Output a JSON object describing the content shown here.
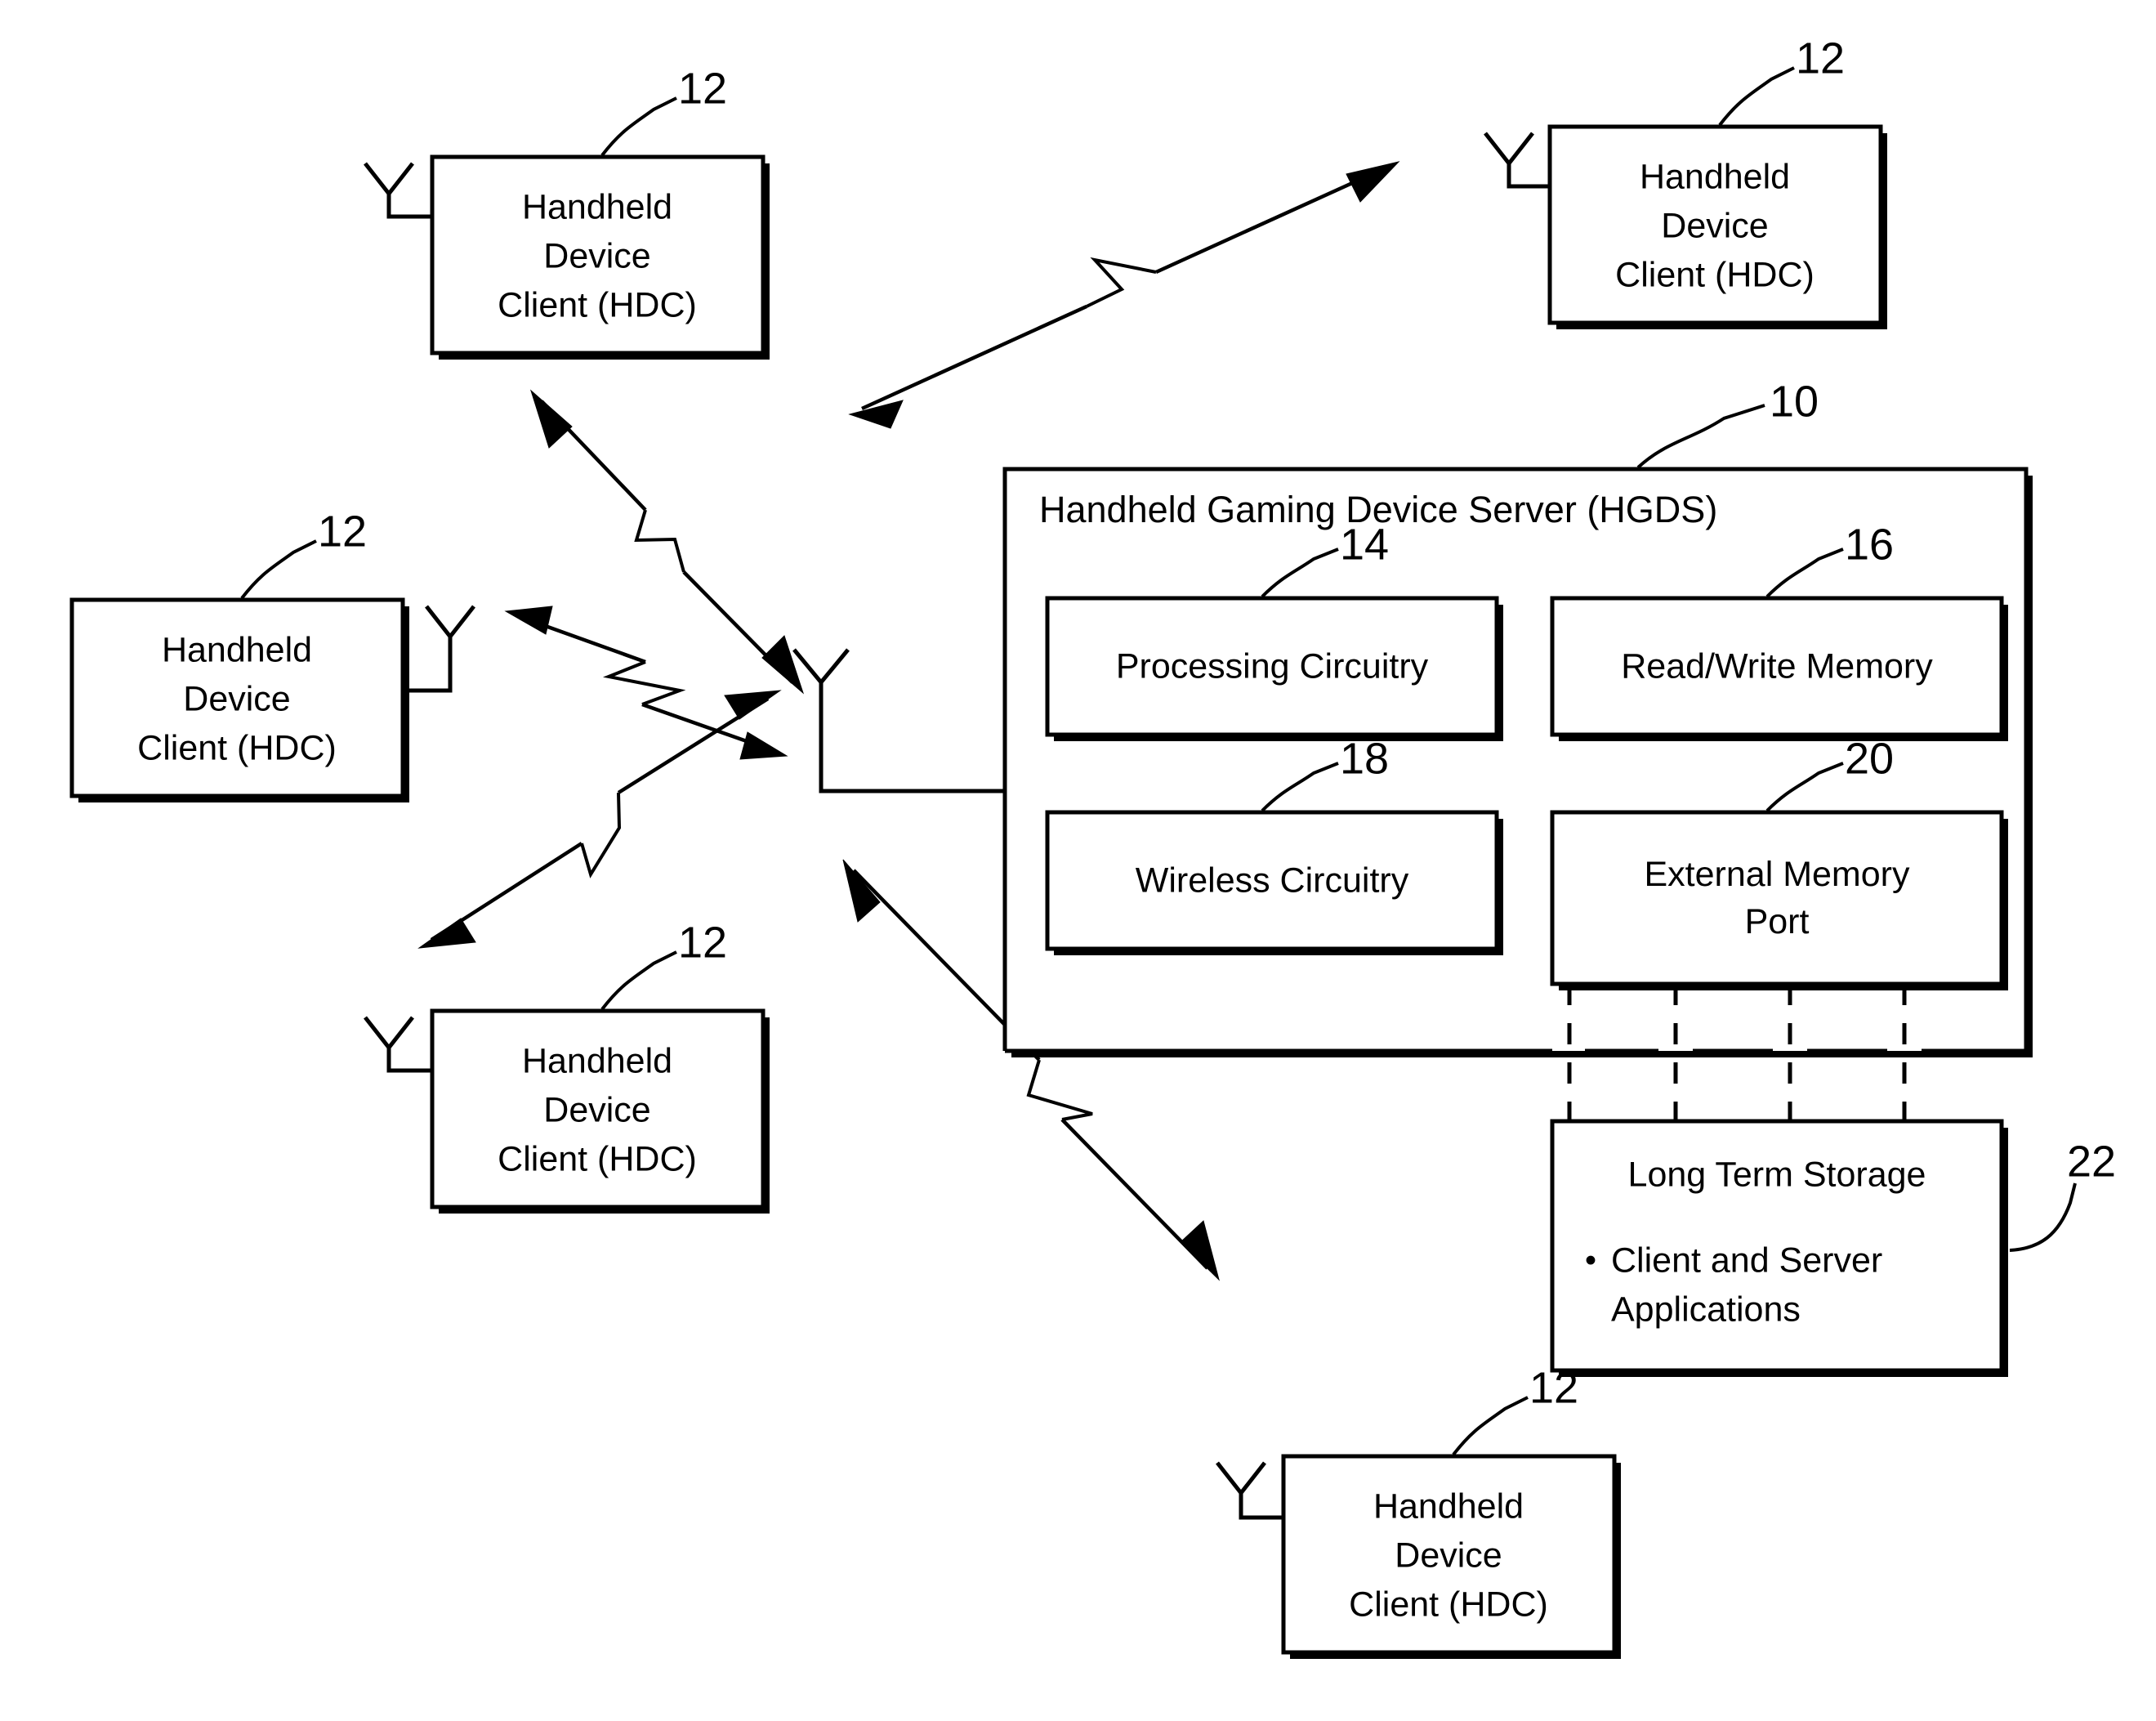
{
  "figure": {
    "type": "patent-block-diagram",
    "background_color": "#ffffff",
    "line_color": "#000000"
  },
  "server": {
    "title": "Handheld Gaming Device Server (HGDS)",
    "ref": "10",
    "components": [
      {
        "label": "Processing Circuitry",
        "ref": "14"
      },
      {
        "label": "Read/Write Memory",
        "ref": "16"
      },
      {
        "label": "Wireless Circuitry",
        "ref": "18"
      },
      {
        "label": "External Memory Port",
        "ref": "20"
      }
    ]
  },
  "storage": {
    "title": "Long Term Storage",
    "bullet_glyph": "•",
    "items": [
      {
        "line1": "Client and Server",
        "line2": "Applications"
      }
    ],
    "ref": "22"
  },
  "clients": [
    {
      "id": "hdc-top-left",
      "line1": "Handheld",
      "line2": "Device",
      "line3": "Client (HDC)",
      "ref": "12",
      "antenna_side": "left"
    },
    {
      "id": "hdc-top-right",
      "line1": "Handheld",
      "line2": "Device",
      "line3": "Client (HDC)",
      "ref": "12",
      "antenna_side": "left"
    },
    {
      "id": "hdc-mid-left",
      "line1": "Handheld",
      "line2": "Device",
      "line3": "Client (HDC)",
      "ref": "12",
      "antenna_side": "right"
    },
    {
      "id": "hdc-lower-left",
      "line1": "Handheld",
      "line2": "Device",
      "line3": "Client (HDC)",
      "ref": "12",
      "antenna_side": "left"
    },
    {
      "id": "hdc-bottom",
      "line1": "Handheld",
      "line2": "Device",
      "line3": "Client (HDC)",
      "ref": "12",
      "antenna_side": "left"
    }
  ]
}
